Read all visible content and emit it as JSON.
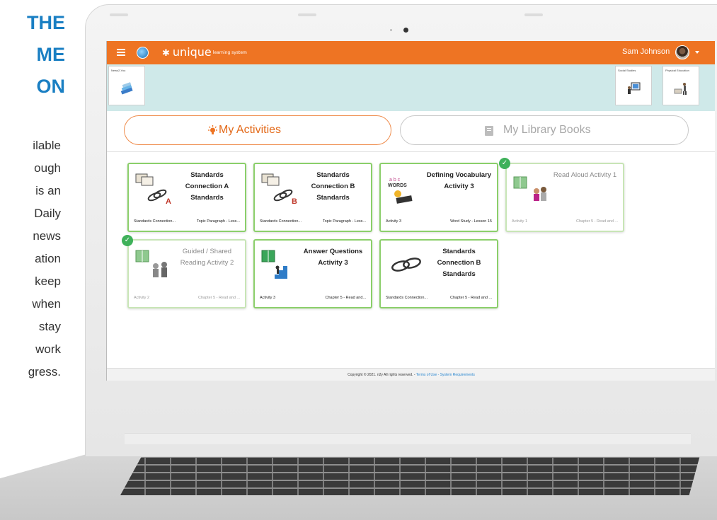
{
  "side_text": {
    "heading_lines": [
      "THE",
      "ME",
      "ON"
    ],
    "paragraph_lines": [
      "ilable",
      "ough",
      "is an",
      "Daily",
      "news",
      "ation",
      "keep",
      "when",
      "stay",
      "work",
      "gress."
    ]
  },
  "app": {
    "brand": "unique",
    "brand_sub": "learning system",
    "user_name": "Sam Johnson"
  },
  "subject_tiles": [
    {
      "label": "News2-You",
      "icon": "book-stack-icon"
    },
    {
      "label": "Social Studies",
      "icon": "presentation-board-icon"
    },
    {
      "label": "Physical Education",
      "icon": "exercise-person-icon"
    }
  ],
  "tabs": {
    "activities_label": "My Activities",
    "library_label": "My Library Books"
  },
  "activities": [
    {
      "title": "Standards Connection A Standards",
      "left": "Standards Connection...",
      "right": "Topic Paragraph - Less...",
      "done": false,
      "icon": "standards-chain-a-icon"
    },
    {
      "title": "Standards Connection B Standards",
      "left": "Standards Connection...",
      "right": "Topic Paragraph - Less...",
      "done": false,
      "icon": "standards-chain-b-icon"
    },
    {
      "title": "Defining Vocabulary Activity 3",
      "left": "Activity 3",
      "right": "Word Study - Lesson 15",
      "done": false,
      "icon": "words-icon"
    },
    {
      "title": "Read Aloud Activity 1",
      "left": "Activity 1",
      "right": "Chapter 5 - Read and ...",
      "done": true,
      "icon": "read-aloud-icon"
    },
    {
      "title": "Guided / Shared Reading Activity 2",
      "left": "Activity 2",
      "right": "Chapter 5 - Read and ...",
      "done": true,
      "icon": "shared-reading-icon"
    },
    {
      "title": "Answer Questions Activity 3",
      "left": "Activity 3",
      "right": "Chapter 5 - Read and...",
      "done": false,
      "icon": "answer-questions-icon"
    },
    {
      "title": "Standards Connection B Standards",
      "left": "Standards Connection...",
      "right": "Chapter 5 - Read and ...",
      "done": false,
      "icon": "chain-link-icon"
    }
  ],
  "footer": {
    "copyright": "Copyright © 2021. n2y All rights reserved. - ",
    "terms": "Terms of Use",
    "sep": " - ",
    "requirements": "System Requirements"
  },
  "colors": {
    "brand_orange": "#ee7423",
    "card_border": "#8bcf6a",
    "done_check": "#3fb15a",
    "band": "#cfe9e9"
  }
}
